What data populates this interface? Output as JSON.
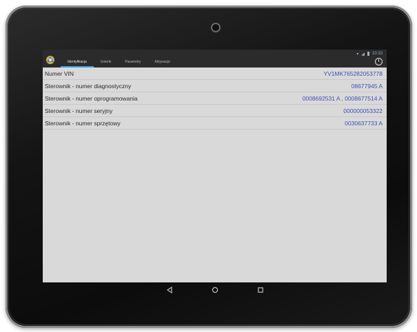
{
  "status_bar": {
    "time": "10:10"
  },
  "tabs": [
    {
      "label": "Identyfikacja",
      "active": true
    },
    {
      "label": "Usterki",
      "active": false
    },
    {
      "label": "Parametry",
      "active": false
    },
    {
      "label": "Aktywacje",
      "active": false
    }
  ],
  "info_icon": "info-icon",
  "rows": [
    {
      "label": "Numer VIN",
      "value": "YV1MK765282053778"
    },
    {
      "label": "Sterownik - numer diagnostyczny",
      "value": "08677945  A"
    },
    {
      "label": "Sterownik - numer oprogramowania",
      "value": "0008692531  A  ,  0008677514  A"
    },
    {
      "label": "Sterownik - numer seryjny",
      "value": "000000053322"
    },
    {
      "label": "Sterownik - numer sprzętowy",
      "value": "0030637733  A"
    }
  ],
  "colors": {
    "value_text": "#3d52b8",
    "tab_indicator": "#3aa0e8",
    "content_bg": "#d9d9d9",
    "bar_bg": "#2b2b2b"
  },
  "nav_icons": [
    "back-icon",
    "home-icon",
    "recents-icon"
  ]
}
